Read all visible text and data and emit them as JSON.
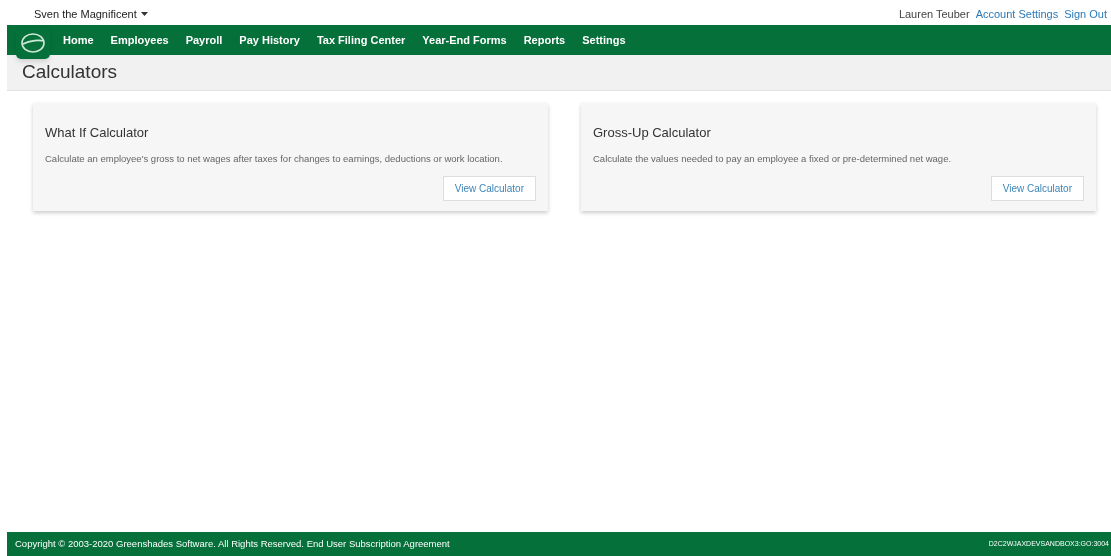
{
  "company_menu": {
    "label": "Sven the Magnificent"
  },
  "user": {
    "name": "Lauren Teuber",
    "links": [
      "Account Settings",
      "Sign Out"
    ]
  },
  "nav": {
    "items": [
      {
        "label": "Home"
      },
      {
        "label": "Employees"
      },
      {
        "label": "Payroll"
      },
      {
        "label": "Pay History"
      },
      {
        "label": "Tax Filing Center"
      },
      {
        "label": "Year-End Forms"
      },
      {
        "label": "Reports"
      },
      {
        "label": "Settings"
      }
    ]
  },
  "page_title": "Calculators",
  "cards": [
    {
      "title": "What If Calculator",
      "description": "Calculate an employee's gross to net wages after taxes for changes to earnings, deductions or work location.",
      "button": "View Calculator"
    },
    {
      "title": "Gross-Up Calculator",
      "description": "Calculate the values needed to pay an employee a fixed or pre-determined net wage.",
      "button": "View Calculator"
    }
  ],
  "footer": {
    "copyright": "Copyright © 2003-2020 Greenshades Software. All Rights Reserved.",
    "link": "End User Subscription Agreement",
    "server": "D2C2WJAXDEVSANDBOX3:GO:3004"
  }
}
